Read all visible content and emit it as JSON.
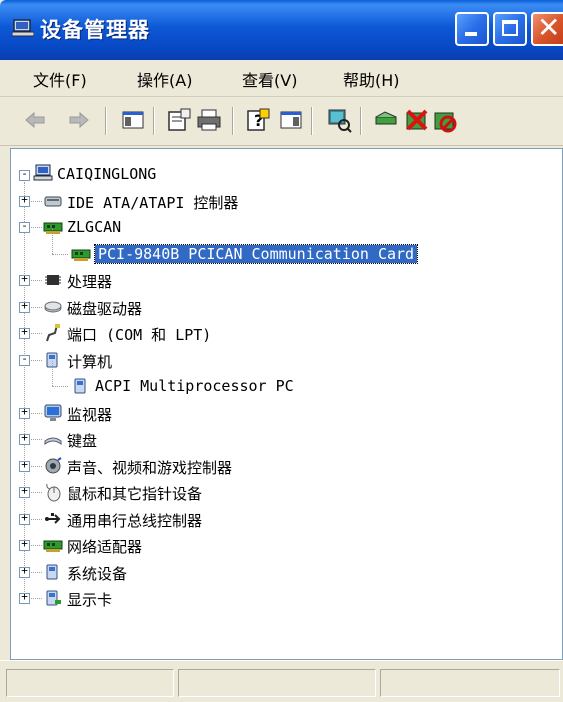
{
  "window": {
    "title": "设备管理器"
  },
  "menu": [
    "文件(F)",
    "操作(A)",
    "查看(V)",
    "帮助(H)"
  ],
  "toolbar": [
    {
      "name": "back-arrow-icon"
    },
    {
      "name": "forward-arrow-icon"
    },
    {
      "name": "show-hide-console-tree-icon"
    },
    {
      "name": "properties-icon"
    },
    {
      "name": "print-icon"
    },
    {
      "name": "help-icon"
    },
    {
      "name": "show-hide-action-pane-icon"
    },
    {
      "name": "scan-hardware-changes-icon"
    },
    {
      "name": "update-driver-icon"
    },
    {
      "name": "uninstall-icon"
    },
    {
      "name": "disable-device-icon"
    }
  ],
  "tree": {
    "root": "CAIQINGLONG",
    "nodes": [
      {
        "label": "IDE ATA/ATAPI 控制器",
        "icon": "ide-controller-icon",
        "level": 1,
        "expander": "+"
      },
      {
        "label": "ZLGCAN",
        "icon": "network-card-icon",
        "level": 1,
        "expander": "-"
      },
      {
        "label": "PCI-9840B PCICAN Communication Card",
        "icon": "network-card-icon",
        "level": 2,
        "expander": "",
        "selected": true
      },
      {
        "label": "处理器",
        "icon": "processor-icon",
        "level": 1,
        "expander": "+"
      },
      {
        "label": "磁盘驱动器",
        "icon": "disk-drive-icon",
        "level": 1,
        "expander": "+"
      },
      {
        "label": "端口 (COM 和 LPT)",
        "icon": "port-icon",
        "level": 1,
        "expander": "+"
      },
      {
        "label": "计算机",
        "icon": "computer-icon",
        "level": 1,
        "expander": "-"
      },
      {
        "label": "ACPI Multiprocessor PC",
        "icon": "computer-icon",
        "level": 2,
        "expander": ""
      },
      {
        "label": "监视器",
        "icon": "monitor-icon",
        "level": 1,
        "expander": "+"
      },
      {
        "label": "键盘",
        "icon": "keyboard-icon",
        "level": 1,
        "expander": "+"
      },
      {
        "label": "声音、视频和游戏控制器",
        "icon": "sound-icon",
        "level": 1,
        "expander": "+"
      },
      {
        "label": "鼠标和其它指针设备",
        "icon": "mouse-icon",
        "level": 1,
        "expander": "+"
      },
      {
        "label": "通用串行总线控制器",
        "icon": "usb-icon",
        "level": 1,
        "expander": "+"
      },
      {
        "label": "网络适配器",
        "icon": "network-card-icon",
        "level": 1,
        "expander": "+"
      },
      {
        "label": "系统设备",
        "icon": "system-device-icon",
        "level": 1,
        "expander": "+"
      },
      {
        "label": "显示卡",
        "icon": "display-adapter-icon",
        "level": 1,
        "expander": "+"
      }
    ]
  },
  "colors": {
    "selection": "#316ac5",
    "titlebar": "#0d58d6"
  }
}
